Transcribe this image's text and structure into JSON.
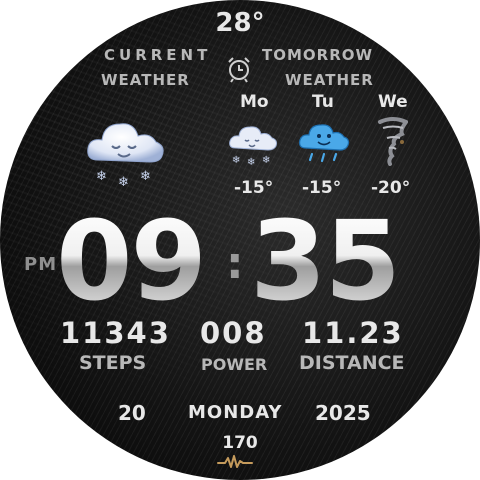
{
  "top_temperature": "28°",
  "current_weather": {
    "line1": "CURRENT",
    "line2": "WEATHER",
    "icon": "snow-cloud-icon"
  },
  "tomorrow_weather": {
    "line1": "TOMORROW",
    "line2": "WEATHER"
  },
  "alarm_icon": "alarm-clock-icon",
  "forecast": [
    {
      "day": "Mo",
      "temp": "-15°",
      "icon": "snow-cloud-icon"
    },
    {
      "day": "Tu",
      "temp": "-15°",
      "icon": "rain-cloud-icon"
    },
    {
      "day": "We",
      "temp": "-20°",
      "icon": "tornado-icon"
    }
  ],
  "time": {
    "ampm": "PM",
    "hours": "09",
    "separator": ":",
    "minutes": "35"
  },
  "stats": {
    "steps_value": "11343",
    "steps_label": "STEPS",
    "power_value": "008",
    "power_label": "POWER",
    "distance_value": "11.23",
    "distance_label": "DISTANCE"
  },
  "date": {
    "day": "20",
    "weekday": "MONDAY",
    "year": "2025"
  },
  "heart_rate": "170",
  "colors": {
    "background": "#000000",
    "text": "#e8e8e8",
    "heart_icon": "#c59b5c"
  }
}
